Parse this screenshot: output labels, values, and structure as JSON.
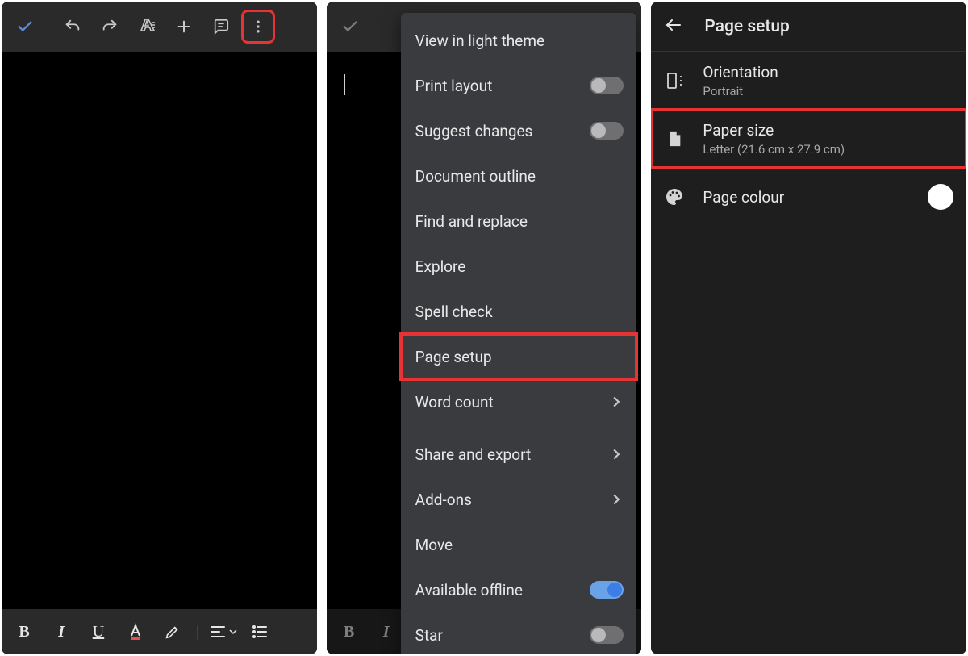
{
  "panel1": {
    "toolbar_icons": [
      "checkmark-icon",
      "undo-icon",
      "redo-icon",
      "text-format-icon",
      "plus-icon",
      "comment-icon",
      "more-icon"
    ],
    "format_icons": [
      "bold-icon",
      "italic-icon",
      "underline-icon",
      "text-color-icon",
      "highlight-icon",
      "align-icon",
      "list-icon"
    ]
  },
  "panel2": {
    "menu": {
      "view_light": "View in light theme",
      "print_layout": "Print layout",
      "suggest_changes": "Suggest changes",
      "document_outline": "Document outline",
      "find_replace": "Find and replace",
      "explore": "Explore",
      "spell_check": "Spell check",
      "page_setup": "Page setup",
      "word_count": "Word count",
      "share_export": "Share and export",
      "add_ons": "Add-ons",
      "move": "Move",
      "available_offline": "Available offline",
      "star": "Star"
    }
  },
  "panel3": {
    "title": "Page setup",
    "orientation": {
      "label": "Orientation",
      "value": "Portrait"
    },
    "paper_size": {
      "label": "Paper size",
      "value": "Letter (21.6 cm x 27.9 cm)"
    },
    "page_colour": {
      "label": "Page colour",
      "colour": "#ffffff"
    }
  }
}
